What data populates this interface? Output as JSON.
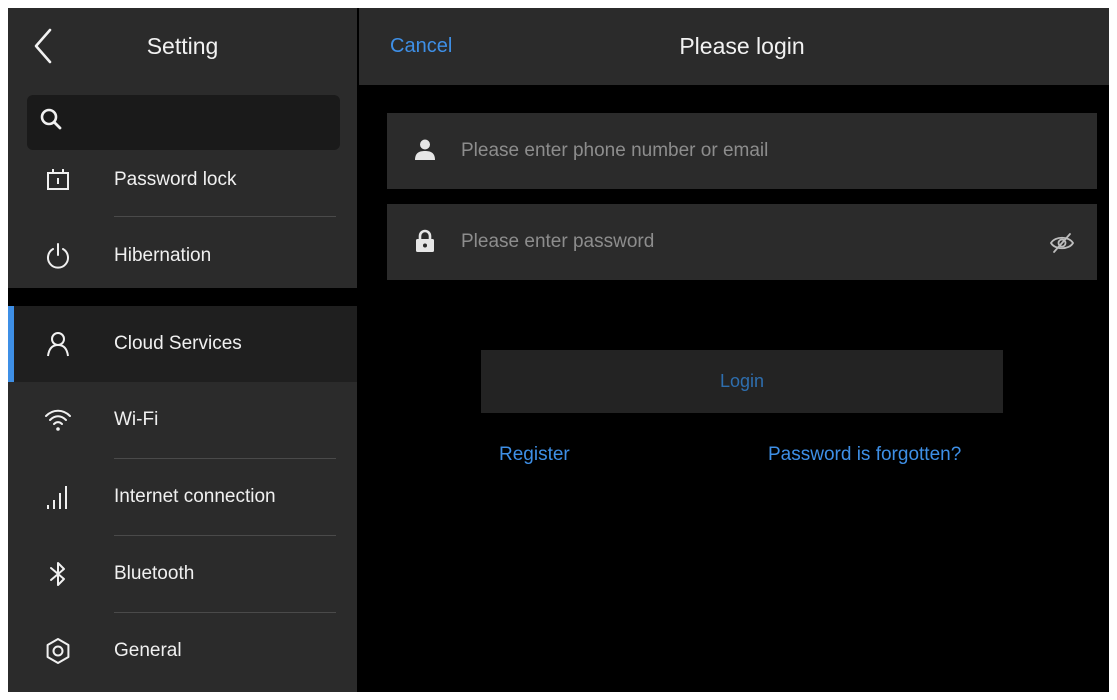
{
  "sidebar": {
    "title": "Setting",
    "search": {
      "placeholder": ""
    },
    "group_top": [
      {
        "label": "Password lock",
        "icon": "password-lock-icon"
      },
      {
        "label": "Hibernation",
        "icon": "power-icon"
      }
    ],
    "group_main": [
      {
        "label": "Cloud Services",
        "icon": "user-icon",
        "active": true
      },
      {
        "label": "Wi-Fi",
        "icon": "wifi-icon"
      },
      {
        "label": "Internet connection",
        "icon": "signal-bars-icon"
      },
      {
        "label": "Bluetooth",
        "icon": "bluetooth-icon"
      },
      {
        "label": "General",
        "icon": "gear-icon"
      }
    ]
  },
  "header": {
    "cancel_label": "Cancel",
    "title": "Please login"
  },
  "form": {
    "account": {
      "value": "",
      "placeholder": "Please enter phone number or email",
      "icon": "person-icon"
    },
    "password": {
      "value": "",
      "placeholder": "Please enter password",
      "icon": "lock-icon",
      "toggle_icon": "eye-off-icon"
    },
    "login_label": "Login",
    "register_label": "Register",
    "forgot_label": "Password is forgotten?"
  },
  "colors": {
    "accent": "#3e8fe6",
    "panel": "#2b2b2b",
    "background": "#000000"
  }
}
